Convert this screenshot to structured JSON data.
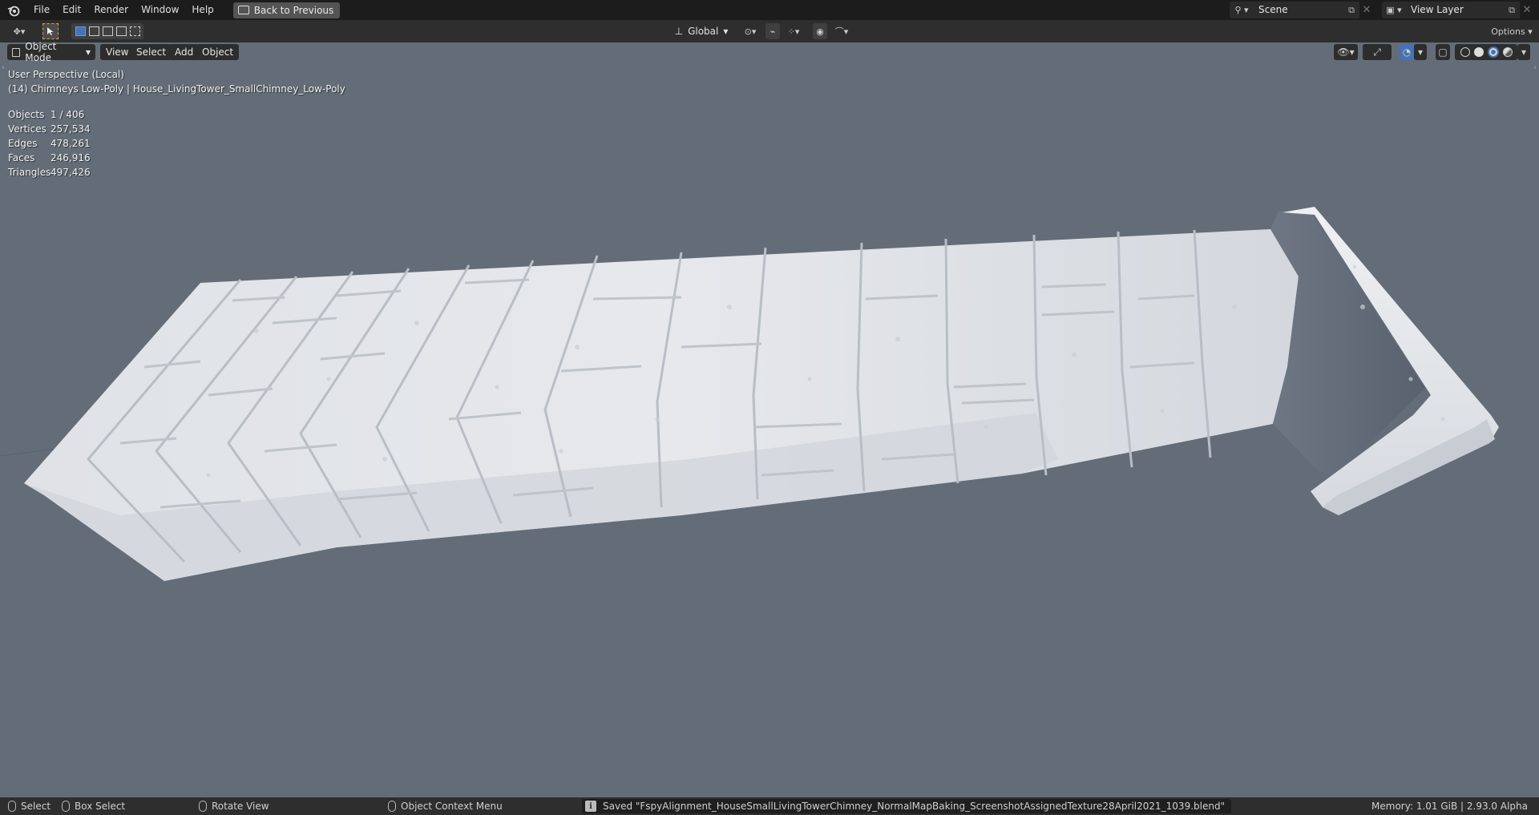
{
  "topbar": {
    "menus": [
      "File",
      "Edit",
      "Render",
      "Window",
      "Help"
    ],
    "back_button": "Back to Previous",
    "scene": "Scene",
    "view_layer": "View Layer"
  },
  "toolbar": {
    "orientation": "Global",
    "options": "Options"
  },
  "viewport_header": {
    "mode": "Object Mode",
    "menus": [
      "View",
      "Select",
      "Add",
      "Object"
    ]
  },
  "overlay": {
    "perspective": "User Perspective (Local)",
    "object_info": "(14) Chimneys Low-Poly | House_LivingTower_SmallChimney_Low-Poly",
    "stats": [
      {
        "label": "Objects",
        "value": "1 / 406"
      },
      {
        "label": "Vertices",
        "value": "257,534"
      },
      {
        "label": "Edges",
        "value": "478,261"
      },
      {
        "label": "Faces",
        "value": "246,916"
      },
      {
        "label": "Triangles",
        "value": "497,426"
      }
    ]
  },
  "statusbar": {
    "select": "Select",
    "box_select": "Box Select",
    "rotate_view": "Rotate View",
    "context_menu": "Object Context Menu",
    "saved_message": "Saved \"FspyAlignment_HouseSmallLivingTowerChimney_NormalMapBaking_ScreenshotAssignedTexture28April2021_1039.blend\"",
    "memory": "Memory: 1.01 GiB | 2.93.0 Alpha"
  },
  "colors": {
    "viewport_bg": "#646d77",
    "header_bg": "#1c1c1c",
    "toolbar_bg": "#2e2e2e",
    "model": "#e8eaee",
    "active_accent": "#4772b3"
  }
}
